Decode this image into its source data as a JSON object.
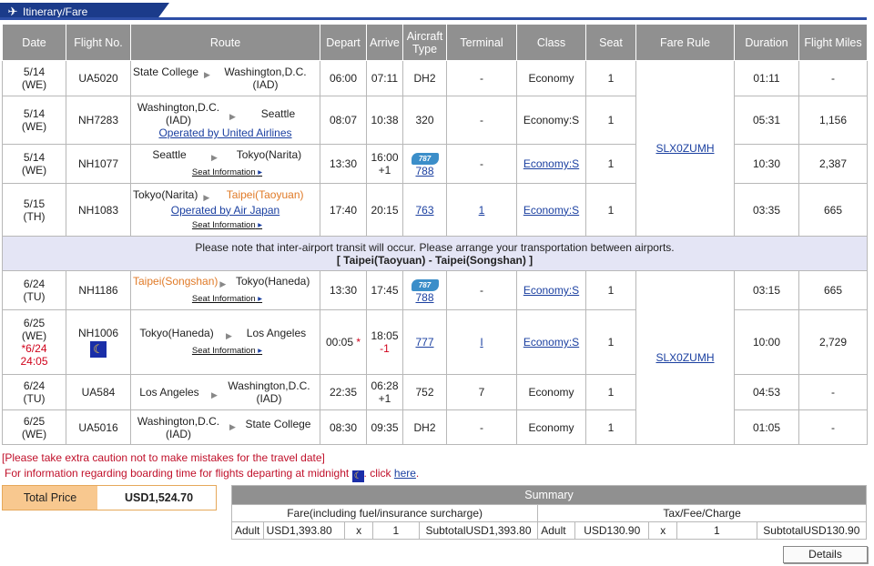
{
  "header": {
    "title": "Itinerary/Fare"
  },
  "columns": [
    "Date",
    "Flight No.",
    "Route",
    "Depart",
    "Arrive",
    "Aircraft Type",
    "Terminal",
    "Class",
    "Seat",
    "Fare Rule",
    "Duration",
    "Flight Miles"
  ],
  "columns_html": {
    "aircraft": [
      "Aircraft",
      "Type"
    ]
  },
  "fare_rules": {
    "outbound": "SLX0ZUMH",
    "return": "SLX0ZUMH"
  },
  "seat_info_label": "Seat Information",
  "segments": [
    {
      "date_a": "5/14",
      "date_b": "(WE)",
      "flight": "UA5020",
      "from": "State College",
      "to": "Washington,D.C. (IAD)",
      "operated": "",
      "depart": "06:00",
      "arrive": "07:11",
      "aircraft": "DH2",
      "terminal": "-",
      "class": "Economy",
      "seat": "1",
      "duration": "01:11",
      "miles": "-"
    },
    {
      "date_a": "5/14",
      "date_b": "(WE)",
      "flight": "NH7283",
      "from": "Washington,D.C. (IAD)",
      "to": "Seattle",
      "operated": "Operated by United Airlines",
      "depart": "08:07",
      "arrive": "10:38",
      "aircraft": "320",
      "terminal": "-",
      "class": "Economy:S",
      "seat": "1",
      "duration": "05:31",
      "miles": "1,156"
    },
    {
      "date_a": "5/14",
      "date_b": "(WE)",
      "flight": "NH1077",
      "from": "Seattle",
      "to": "Tokyo(Narita)",
      "depart": "13:30",
      "arrive_a": "16:00",
      "arrive_b": "+1",
      "badge": "787",
      "aircraft": "788",
      "terminal": "-",
      "class": "Economy:S",
      "seat": "1",
      "duration": "10:30",
      "miles": "2,387"
    },
    {
      "date_a": "5/15",
      "date_b": "(TH)",
      "flight": "NH1083",
      "from": "Tokyo(Narita)",
      "to": "Taipei(Taoyuan)",
      "operated": "Operated by Air Japan",
      "depart": "17:40",
      "arrive": "20:15",
      "aircraft": "763",
      "terminal": "1",
      "class": "Economy:S",
      "seat": "1",
      "duration": "03:35",
      "miles": "665"
    },
    {
      "date_a": "6/24",
      "date_b": "(TU)",
      "flight": "NH1186",
      "from": "Taipei(Songshan)",
      "to": "Tokyo(Haneda)",
      "depart": "13:30",
      "arrive": "17:45",
      "badge": "787",
      "aircraft": "788",
      "terminal": "-",
      "class": "Economy:S",
      "seat": "1",
      "duration": "03:15",
      "miles": "665"
    },
    {
      "date_a": "6/25",
      "date_b": "(WE)",
      "date_c": "*6/24",
      "date_d": "24:05",
      "flight": "NH1006",
      "from": "Tokyo(Haneda)",
      "to": "Los Angeles",
      "depart": "00:05",
      "depart_mark": "*",
      "arrive_a": "18:05",
      "arrive_b": "-1",
      "aircraft": "777",
      "terminal": "I",
      "class": "Economy:S",
      "seat": "1",
      "duration": "10:00",
      "miles": "2,729"
    },
    {
      "date_a": "6/24",
      "date_b": "(TU)",
      "flight": "UA584",
      "from": "Los Angeles",
      "to": "Washington,D.C. (IAD)",
      "depart": "22:35",
      "arrive_a": "06:28",
      "arrive_b": "+1",
      "aircraft": "752",
      "terminal": "7",
      "class": "Economy",
      "seat": "1",
      "duration": "04:53",
      "miles": "-"
    },
    {
      "date_a": "6/25",
      "date_b": "(WE)",
      "flight": "UA5016",
      "from": "Washington,D.C. (IAD)",
      "to": "State College",
      "depart": "08:30",
      "arrive": "09:35",
      "aircraft": "DH2",
      "terminal": "-",
      "class": "Economy",
      "seat": "1",
      "duration": "01:05",
      "miles": "-"
    }
  ],
  "transit_notice": {
    "line1": "Please note that inter-airport transit will occur. Please arrange your transportation between airports.",
    "line2": "[ Taipei(Taoyuan) - Taipei(Songshan) ]"
  },
  "warnings": {
    "line1": "[Please take extra caution not to make mistakes for the travel date]",
    "line2_pre": "For information regarding boarding time for flights departing at midnight",
    "line2_mid": ". click",
    "link": "here",
    "line2_end": "."
  },
  "total": {
    "label": "Total Price",
    "value": "USD1,524.70"
  },
  "summary": {
    "title": "Summary",
    "fare_header": "Fare(including fuel/insurance surcharge)",
    "tax_header": "Tax/Fee/Charge",
    "row": {
      "pax": "Adult",
      "fare": "USD1,393.80",
      "x": "x",
      "count": "1",
      "fare_sub": "SubtotalUSD1,393.80",
      "pax2": "Adult",
      "tax": "USD130.90",
      "x2": "x",
      "count2": "1",
      "tax_sub": "SubtotalUSD130.90"
    }
  },
  "details_button": "Details"
}
